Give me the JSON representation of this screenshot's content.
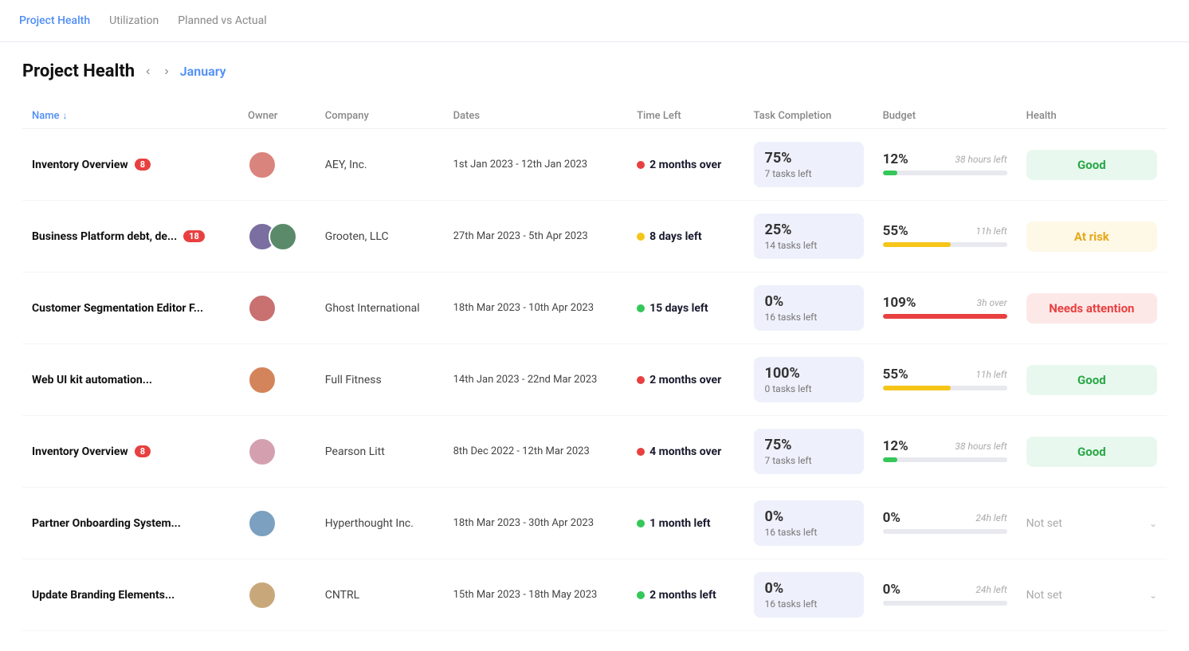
{
  "nav": {
    "tabs": [
      {
        "id": "project-health",
        "label": "Project Health",
        "active": true
      },
      {
        "id": "utilization",
        "label": "Utilization",
        "active": false
      },
      {
        "id": "planned-vs-actual",
        "label": "Planned vs Actual",
        "active": false
      }
    ]
  },
  "header": {
    "title": "Project Health",
    "month": "January"
  },
  "table": {
    "columns": [
      {
        "id": "name",
        "label": "Name",
        "sort": "asc"
      },
      {
        "id": "owner",
        "label": "Owner"
      },
      {
        "id": "company",
        "label": "Company"
      },
      {
        "id": "dates",
        "label": "Dates"
      },
      {
        "id": "time-left",
        "label": "Time Left"
      },
      {
        "id": "task-completion",
        "label": "Task Completion"
      },
      {
        "id": "budget",
        "label": "Budget"
      },
      {
        "id": "health",
        "label": "Health"
      }
    ],
    "rows": [
      {
        "name": "Inventory Overview",
        "badge": "8",
        "owner_count": 1,
        "owner_colors": [
          "#d9847c"
        ],
        "company": "AEY, Inc.",
        "dates": "1st Jan 2023 - 12th Jan 2023",
        "time_left": "2 months over",
        "time_dot": "red",
        "task_pct": "75%",
        "task_sub": "7 tasks left",
        "budget_pct": "12%",
        "budget_bar_pct": 12,
        "budget_bar_color": "green",
        "budget_hours": "38 hours left",
        "health": "Good",
        "health_type": "good"
      },
      {
        "name": "Business Platform debt, de...",
        "badge": "18",
        "owner_count": 2,
        "owner_colors": [
          "#7B6EA0",
          "#5B8A6A"
        ],
        "company": "Grooten, LLC",
        "dates": "27th Mar 2023 - 5th Apr 2023",
        "time_left": "8 days left",
        "time_dot": "yellow",
        "task_pct": "25%",
        "task_sub": "14 tasks left",
        "budget_pct": "55%",
        "budget_bar_pct": 55,
        "budget_bar_color": "yellow",
        "budget_hours": "11h left",
        "health": "At risk",
        "health_type": "at-risk"
      },
      {
        "name": "Customer Segmentation Editor F...",
        "badge": null,
        "owner_count": 1,
        "owner_colors": [
          "#C97070"
        ],
        "company": "Ghost International",
        "dates": "18th Mar 2023 - 10th Apr 2023",
        "time_left": "15 days left",
        "time_dot": "green",
        "task_pct": "0%",
        "task_sub": "16 tasks left",
        "budget_pct": "109%",
        "budget_bar_pct": 100,
        "budget_bar_color": "red",
        "budget_hours": "3h over",
        "health": "Needs attention",
        "health_type": "needs-attention"
      },
      {
        "name": "Web UI kit automation...",
        "badge": null,
        "owner_count": 1,
        "owner_colors": [
          "#D4845A"
        ],
        "company": "Full Fitness",
        "dates": "14th Jan 2023 - 22nd Mar 2023",
        "time_left": "2 months over",
        "time_dot": "red",
        "task_pct": "100%",
        "task_sub": "0 tasks left",
        "budget_pct": "55%",
        "budget_bar_pct": 55,
        "budget_bar_color": "yellow",
        "budget_hours": "11h left",
        "health": "Good",
        "health_type": "good"
      },
      {
        "name": "Inventory Overview",
        "badge": "8",
        "owner_count": 1,
        "owner_colors": [
          "#D4A0B0"
        ],
        "company": "Pearson Litt",
        "dates": "8th Dec 2022 - 12th Mar 2023",
        "time_left": "4 months over",
        "time_dot": "red",
        "task_pct": "75%",
        "task_sub": "7 tasks left",
        "budget_pct": "12%",
        "budget_bar_pct": 12,
        "budget_bar_color": "green",
        "budget_hours": "38 hours left",
        "health": "Good",
        "health_type": "good"
      },
      {
        "name": "Partner Onboarding System...",
        "badge": null,
        "owner_count": 1,
        "owner_colors": [
          "#7BA0C0"
        ],
        "company": "Hyperthought Inc.",
        "dates": "18th Mar 2023 - 30th Apr 2023",
        "time_left": "1 month left",
        "time_dot": "green",
        "task_pct": "0%",
        "task_sub": "16 tasks left",
        "budget_pct": "0%",
        "budget_bar_pct": 0,
        "budget_bar_color": "green",
        "budget_hours": "24h left",
        "health": "Not set",
        "health_type": "not-set"
      },
      {
        "name": "Update Branding Elements...",
        "badge": null,
        "owner_count": 1,
        "owner_colors": [
          "#C8A87A"
        ],
        "company": "CNTRL",
        "dates": "15th Mar 2023 - 18th May 2023",
        "time_left": "2 months left",
        "time_dot": "green",
        "task_pct": "0%",
        "task_sub": "16 tasks left",
        "budget_pct": "0%",
        "budget_bar_pct": 0,
        "budget_bar_color": "green",
        "budget_hours": "24h left",
        "health": "Not set",
        "health_type": "not-set"
      }
    ]
  }
}
